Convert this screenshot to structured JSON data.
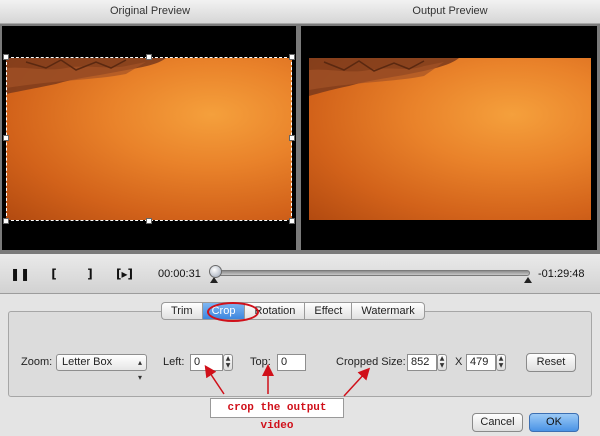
{
  "header": {
    "original_preview": "Original Preview",
    "output_preview": "Output Preview"
  },
  "playback": {
    "current_time": "00:00:31",
    "remaining_time": "-01:29:48",
    "progress": 0.01,
    "play_pause_icon": "pause-icon",
    "mark_in_icon": "bracket-left-icon",
    "mark_out_icon": "bracket-right-icon",
    "next_frame_icon": "next-frame-icon"
  },
  "tabs": [
    {
      "label": "Trim",
      "active": false
    },
    {
      "label": "Crop",
      "active": true
    },
    {
      "label": "Rotation",
      "active": false
    },
    {
      "label": "Effect",
      "active": false
    },
    {
      "label": "Watermark",
      "active": false
    }
  ],
  "crop": {
    "zoom_label": "Zoom:",
    "zoom_value": "Letter Box",
    "left_label": "Left:",
    "left_value": "0",
    "top_label": "Top:",
    "top_value": "0",
    "cropped_size_label": "Cropped Size:",
    "width_value": "852",
    "x_separator": "X",
    "height_value": "479",
    "reset_label": "Reset"
  },
  "annotation": {
    "text": "crop the output video",
    "color": "#d0101a"
  },
  "footer": {
    "cancel_label": "Cancel",
    "ok_label": "OK"
  },
  "colors": {
    "accent": "#4a93e6",
    "annotation_red": "#d0101a"
  }
}
